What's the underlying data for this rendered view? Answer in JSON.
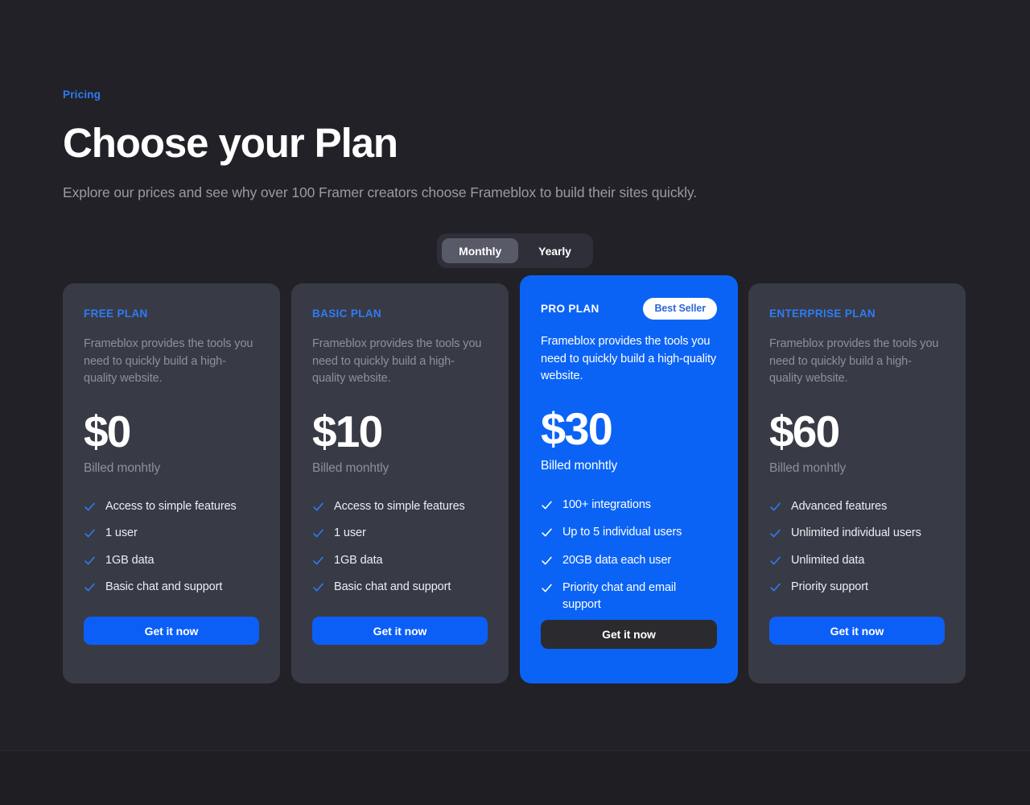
{
  "page": {
    "background_color": "#212127",
    "accent_color": "#0b63f6"
  },
  "header": {
    "eyebrow": "Pricing",
    "headline": "Choose your Plan",
    "subhead": "Explore our prices and see why over 100 Framer creators choose Frameblox to build their sites quickly."
  },
  "billing_toggle": {
    "selected": "Monthly",
    "options": [
      {
        "label": "Monthly",
        "active": true
      },
      {
        "label": "Yearly",
        "active": false
      }
    ]
  },
  "plans": [
    {
      "name": "FREE PLAN",
      "badge": "",
      "description": "Frameblox provides the tools you need to quickly build a high-quality website.",
      "price": "$0",
      "billing_note": "Billed monhtly",
      "features": [
        "Access to simple features",
        "1 user",
        "1GB data",
        "Basic chat and support"
      ],
      "cta_label": "Get it now",
      "featured": false
    },
    {
      "name": "BASIC PLAN",
      "badge": "",
      "description": "Frameblox provides the tools you need to quickly build a high-quality website.",
      "price": "$10",
      "billing_note": "Billed monhtly",
      "features": [
        "Access to simple features",
        "1 user",
        "1GB data",
        "Basic chat and support"
      ],
      "cta_label": "Get it now",
      "featured": false
    },
    {
      "name": "PRO PLAN",
      "badge": "Best Seller",
      "description": "Frameblox provides the tools you need to quickly build a high-quality website.",
      "price": "$30",
      "billing_note": "Billed monhtly",
      "features": [
        "100+ integrations",
        "Up to 5 individual users",
        "20GB data each user",
        "Priority chat and email support"
      ],
      "cta_label": "Get it now",
      "featured": true
    },
    {
      "name": "ENTERPRISE PLAN",
      "badge": "",
      "description": "Frameblox provides the tools you need to quickly build a high-quality website.",
      "price": "$60",
      "billing_note": "Billed monhtly",
      "features": [
        "Advanced features",
        "Unlimited individual users",
        "Unlimited data",
        "Priority support"
      ],
      "cta_label": "Get it now",
      "featured": false
    }
  ]
}
